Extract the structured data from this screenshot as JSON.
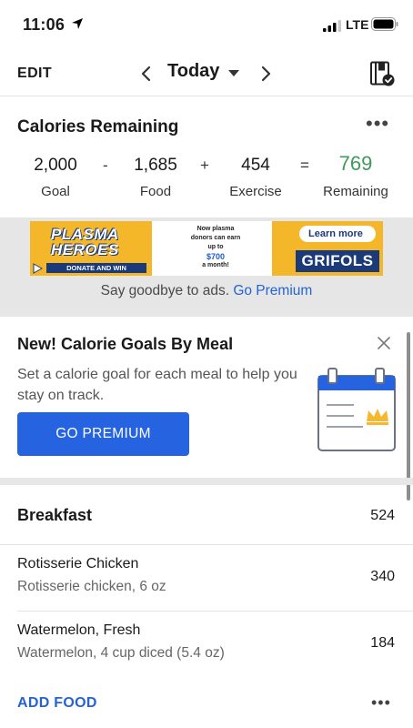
{
  "status_bar": {
    "time": "11:06",
    "network": "LTE"
  },
  "nav": {
    "edit_label": "EDIT",
    "date_label": "Today"
  },
  "calories": {
    "title": "Calories Remaining",
    "goal": {
      "value": "2,000",
      "label": "Goal"
    },
    "food": {
      "value": "1,685",
      "label": "Food"
    },
    "exercise": {
      "value": "454",
      "label": "Exercise"
    },
    "remaining": {
      "value": "769",
      "label": "Remaining"
    },
    "op_minus": "-",
    "op_plus": "+",
    "op_equals": "=",
    "remaining_color": "#3f9a5b"
  },
  "ad": {
    "line1": "PLASMA",
    "line2": "HEROES",
    "donate": "DONATE AND WIN",
    "mid_text": "Now plasma donors can earn up to",
    "mid_amount": "$700",
    "mid_suffix": "a month!",
    "learn_more": "Learn more",
    "brand": "GRIFOLS",
    "caption_prefix": "Say goodbye to ads. ",
    "caption_link": "Go Premium"
  },
  "promo": {
    "title": "New! Calorie Goals By Meal",
    "body": "Set a calorie goal for each meal to help you stay on track.",
    "button_label": "GO PREMIUM"
  },
  "meal": {
    "title": "Breakfast",
    "total": "524",
    "items": [
      {
        "name": "Rotisserie Chicken",
        "desc": "Rotisserie chicken, 6 oz",
        "calories": "340"
      },
      {
        "name": "Watermelon, Fresh",
        "desc": "Watermelon, 4 cup diced (5.4 oz)",
        "calories": "184"
      }
    ],
    "add_food_label": "ADD FOOD"
  },
  "colors": {
    "accent": "#2563e0",
    "link": "#2563d4",
    "ad_gold": "#f4b72a",
    "ad_navy": "#1b3a7a"
  },
  "icons": [
    "location-arrow-icon",
    "signal-bars-icon",
    "battery-icon",
    "chevron-left-icon",
    "caret-down-icon",
    "chevron-right-icon",
    "diary-complete-icon",
    "more-dots-icon",
    "close-icon",
    "calendar-crown-icon"
  ]
}
